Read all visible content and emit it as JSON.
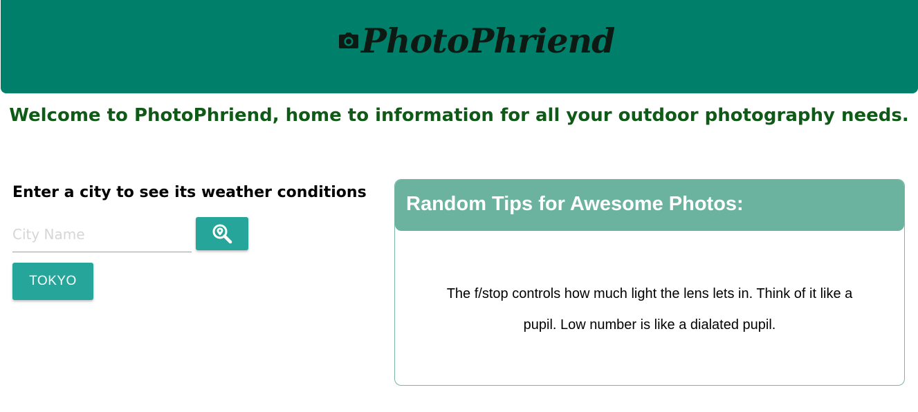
{
  "header": {
    "brand": "PhotoPhriend",
    "brand_icon": "camera-icon",
    "background_color": "#00806a"
  },
  "welcome": {
    "text": "Welcome to PhotoPhriend, home to information for all your outdoor photography needs.",
    "color": "#0f5a16"
  },
  "weather": {
    "title": "Enter a city to see its weather conditions",
    "input_placeholder": "City Name",
    "input_value": "",
    "search_icon": "location-search-icon",
    "recent_cities": [
      "TOKYO"
    ],
    "button_color": "#26a69a"
  },
  "tips": {
    "title": "Random Tips for Awesome Photos:",
    "tip": "The f/stop controls how much light the lens lets in. Think of it like a pupil. Low number is like a dialated pupil.",
    "header_color": "#6cb39f"
  }
}
